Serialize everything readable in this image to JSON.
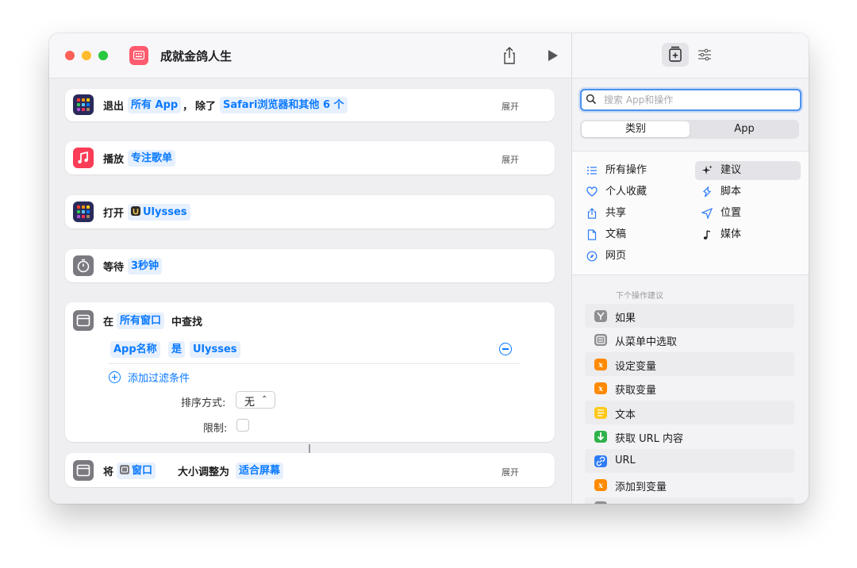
{
  "window": {
    "title": "成就金鸽人生",
    "traffic_lights": [
      "#fe5f57",
      "#febc2e",
      "#28c840"
    ],
    "app_icon": "keyboard-icon",
    "app_icon_color": "#ff5a6e"
  },
  "actions": [
    {
      "icon": "app-grid-icon",
      "verb": "退出",
      "param1": "所有 App",
      "sep": "，",
      "verb2": "除了",
      "param2": "Safari浏览器和其他 6 个",
      "expand": "展开"
    },
    {
      "icon": "music-icon",
      "verb": "播放",
      "param1": "专注歌单",
      "expand": "展开"
    },
    {
      "icon": "app-grid-icon",
      "verb": "打开",
      "param1": "Ulysses"
    },
    {
      "icon": "stopwatch-icon",
      "verb": "等待",
      "param1": "3秒钟"
    },
    {
      "icon": "window-icon",
      "verb": "在",
      "param1": "所有窗口",
      "verb2": "中查找",
      "filter": {
        "field": "App名称",
        "op": "是",
        "value": "Ulysses"
      },
      "add_filter": "添加过滤条件",
      "sort_label": "排序方式:",
      "sort_value": "无",
      "limit_label": "限制:"
    },
    {
      "icon": "window-icon",
      "verb": "将",
      "param1": "窗口",
      "verb2": "大小调整为",
      "param2": "适合屏幕",
      "expand": "展开"
    }
  ],
  "sidebar": {
    "search_placeholder": "搜索 App和操作",
    "segments": [
      "类别",
      "App"
    ],
    "categories": [
      {
        "label": "所有操作",
        "icon": "list-icon"
      },
      {
        "label": "建议",
        "icon": "sparkle-icon",
        "selected": true
      },
      {
        "label": "个人收藏",
        "icon": "heart-icon"
      },
      {
        "label": "脚本",
        "icon": "script-icon"
      },
      {
        "label": "共享",
        "icon": "share-icon"
      },
      {
        "label": "位置",
        "icon": "location-icon"
      },
      {
        "label": "文稿",
        "icon": "document-icon"
      },
      {
        "label": "媒体",
        "icon": "music-note-icon"
      },
      {
        "label": "网页",
        "icon": "compass-icon"
      }
    ],
    "suggestions_header": "下个操作建议",
    "suggestions": [
      {
        "label": "如果",
        "icon": "branch-icon",
        "color": "#8e8e93"
      },
      {
        "label": "从菜单中选取",
        "icon": "menu-icon",
        "color": "#8e8e93"
      },
      {
        "label": "设定变量",
        "icon": "variable-icon",
        "color": "#ff8a00"
      },
      {
        "label": "获取变量",
        "icon": "variable-icon",
        "color": "#ff8a00"
      },
      {
        "label": "文本",
        "icon": "text-icon",
        "color": "#ffc91a"
      },
      {
        "label": "获取 URL 内容",
        "icon": "download-icon",
        "color": "#30b24a"
      },
      {
        "label": "URL",
        "icon": "link-icon",
        "color": "#2e7cf6"
      },
      {
        "label": "添加到变量",
        "icon": "variable-icon",
        "color": "#ff8a00"
      }
    ]
  },
  "colors": {
    "accent": "#0a7aff",
    "pill_bg": "#e7f0fd"
  }
}
